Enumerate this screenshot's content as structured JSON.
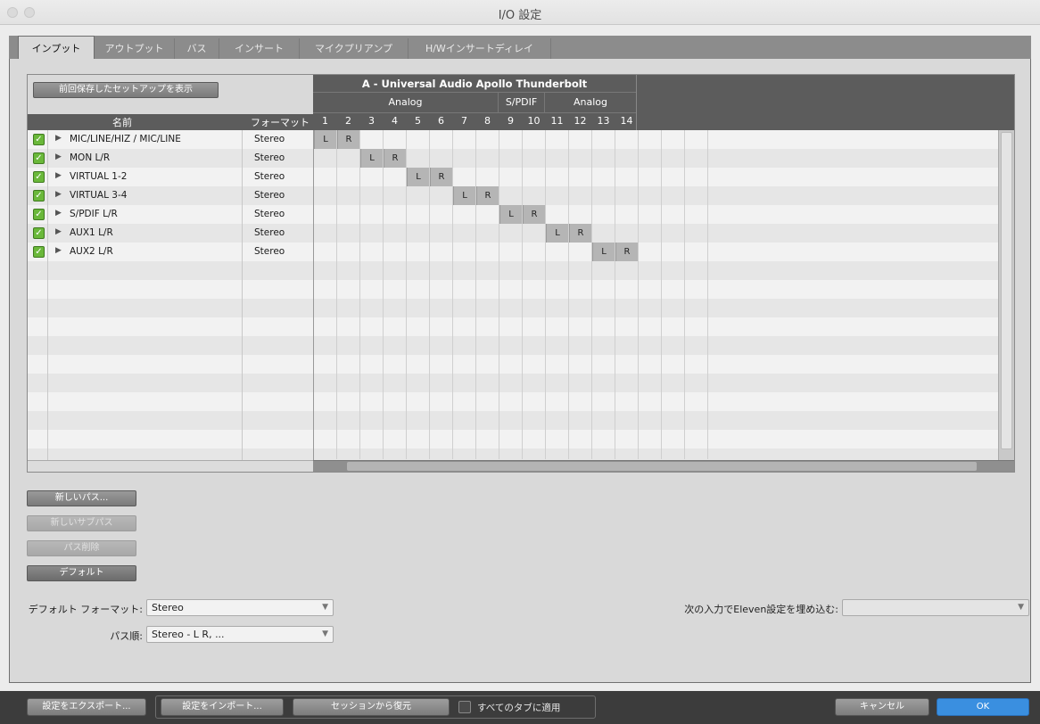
{
  "window": {
    "title": "I/O 設定"
  },
  "tabs": [
    {
      "label": "インプット"
    },
    {
      "label": "アウトプット"
    },
    {
      "label": "バス"
    },
    {
      "label": "インサート"
    },
    {
      "label": "マイクプリアンプ"
    },
    {
      "label": "H/Wインサートディレイ"
    }
  ],
  "grid": {
    "show_previous_button": "前回保存したセットアップを表示",
    "device_title": "A - Universal Audio Apollo Thunderbolt",
    "groups": [
      "Analog",
      "S/PDIF",
      "Analog"
    ],
    "col_name_header": "名前",
    "col_format_header": "フォーマット",
    "channels": [
      "1",
      "2",
      "3",
      "4",
      "5",
      "6",
      "7",
      "8",
      "9",
      "10",
      "11",
      "12",
      "13",
      "14"
    ],
    "rows": [
      {
        "name": "MIC/LINE/HIZ / MIC/LINE",
        "format": "Stereo",
        "left": "L",
        "right": "R"
      },
      {
        "name": "MON L/R",
        "format": "Stereo",
        "left": "L",
        "right": "R"
      },
      {
        "name": "VIRTUAL 1-2",
        "format": "Stereo",
        "left": "L",
        "right": "R"
      },
      {
        "name": "VIRTUAL 3-4",
        "format": "Stereo",
        "left": "L",
        "right": "R"
      },
      {
        "name": "S/PDIF L/R",
        "format": "Stereo",
        "left": "L",
        "right": "R"
      },
      {
        "name": "AUX1 L/R",
        "format": "Stereo",
        "left": "L",
        "right": "R"
      },
      {
        "name": "AUX2 L/R",
        "format": "Stereo",
        "left": "L",
        "right": "R"
      }
    ],
    "check_mark": "✓",
    "expand_glyph": "▶"
  },
  "actions": {
    "new_path": "新しいパス...",
    "new_sub_path": "新しいサブパス",
    "delete_path": "パス削除",
    "default": "デフォルト"
  },
  "settings": {
    "default_format_label": "デフォルト フォーマット:",
    "default_format_value": "Stereo",
    "path_order_label": "パス順:",
    "path_order_value": "Stereo - L R, ...",
    "eleven_label": "次の入力でEleven設定を埋め込む:",
    "eleven_value": "",
    "dropdown_arrow": "▼"
  },
  "footer": {
    "export": "設定をエクスポート...",
    "import": "設定をインポート...",
    "restore": "セッションから復元",
    "apply_all_tabs": "すべてのタブに適用",
    "cancel": "キャンセル",
    "ok": "OK"
  },
  "colors": {
    "ok_button": "#3a8fe0",
    "checkbox_green": "#6ab83a"
  }
}
